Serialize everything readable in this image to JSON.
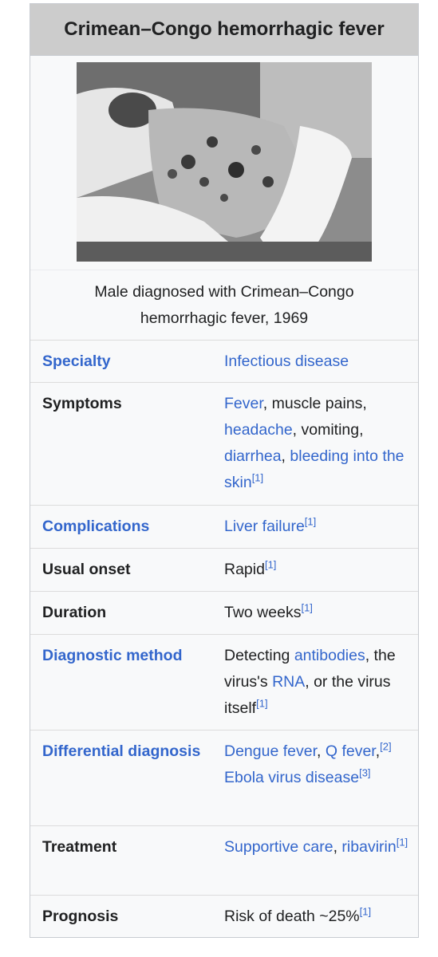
{
  "infobox": {
    "title": "Crimean–Congo hemorrhagic fever",
    "caption": "Male diagnosed with Crimean–Congo hemorrhagic fever, 1969",
    "specialty": {
      "label": "Specialty",
      "value": "Infectious disease"
    },
    "symptoms": {
      "label": "Symptoms",
      "fever": "Fever",
      "t1": ", muscle pains, ",
      "headache": "headache",
      "t2": ", vomiting, ",
      "diarrhea": "diarrhea",
      "t3": ", ",
      "bleeding": "bleeding into the skin",
      "ref": "[1]"
    },
    "complications": {
      "label": "Complications",
      "value": "Liver failure",
      "ref": "[1]"
    },
    "onset": {
      "label": "Usual onset",
      "value": "Rapid",
      "ref": "[1]"
    },
    "duration": {
      "label": "Duration",
      "value": "Two weeks",
      "ref": "[1]"
    },
    "diagnostic": {
      "label": "Diagnostic method",
      "t1": "Detecting ",
      "antibodies": "antibodies",
      "t2": ", the virus's ",
      "rna": "RNA",
      "t3": ", or the virus itself",
      "ref": "[1]"
    },
    "differential": {
      "label": "Differential diagnosis",
      "dengue": "Dengue fever",
      "t1": ", ",
      "q": "Q fever",
      "t2": ",",
      "ref2": "[2]",
      "t3": " ",
      "ebola": "Ebola virus disease",
      "ref3": "[3]"
    },
    "treatment": {
      "label": "Treatment",
      "supportive": "Supportive care",
      "t1": ", ",
      "ribavirin": "ribavirin",
      "ref": "[1]"
    },
    "prognosis": {
      "label": "Prognosis",
      "value": "Risk of death ~25%",
      "ref": "[1]"
    }
  }
}
